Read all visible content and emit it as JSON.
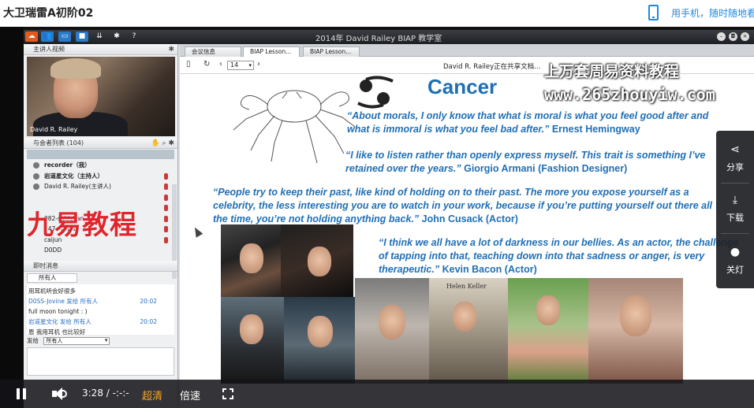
{
  "header": {
    "title": "大卫瑞雷A初阶02",
    "mobile_link": "用手机，随时随地看"
  },
  "app": {
    "title": "2014年 David Railey BIAP 教学室",
    "toolbar_icons": [
      "home-icon",
      "users-icon",
      "chat-icon",
      "video-icon",
      "download-icon",
      "gear-icon",
      "help-icon"
    ]
  },
  "left": {
    "host_video_label": "主讲人视频",
    "host_name": "David R. Railey",
    "participants_label": "与会者列表 (104)",
    "participants": [
      {
        "name": "recorder（我）",
        "bold": true
      },
      {
        "name": "岩道星文化（主持人）",
        "bold": true
      },
      {
        "name": "David R. Railey(主讲人)",
        "bold": false
      },
      {
        "name": "",
        "bold": false
      },
      {
        "name": "",
        "bold": false
      },
      {
        "name": "082-sukichan",
        "bold": false
      },
      {
        "name": "147-vivipan",
        "bold": false
      },
      {
        "name": "caijun",
        "bold": false
      },
      {
        "name": "D0DD",
        "bold": false
      }
    ],
    "watermark": "九易教程",
    "chat_label": "即时消息",
    "chat_tab": "所有人",
    "chat_messages": [
      {
        "text": "用耳机听会好很多",
        "time": "",
        "blue": false
      },
      {
        "text": "D0SS-Jovine 发给 所有人",
        "time": "20:02",
        "blue": true
      },
      {
        "text": "full moon tonight : )",
        "time": "",
        "blue": false
      },
      {
        "text": "岩道星文化 发给 所有人",
        "time": "20:02",
        "blue": true
      },
      {
        "text": "恩 我用耳机 也比较好",
        "time": "",
        "blue": false
      }
    ],
    "send_label": "发给",
    "send_target": "所有人"
  },
  "right": {
    "tabs": [
      "会议信息",
      "BIAP Lesson...",
      "BIAP Lesson..."
    ],
    "page_number": "14",
    "sharing_text": "David R. Railey正在共享文档...",
    "slide": {
      "title": "Cancer",
      "quotes": [
        {
          "text": "“About morals, I only know that what is moral is what you feel good after and what is immoral is what you feel bad after.”",
          "author": "Ernest Hemingway"
        },
        {
          "text": "“I like to listen rather than openly express myself.  This trait is something I’ve retained over the years.”",
          "author": "Giorgio Armani (Fashion Designer)"
        },
        {
          "text": "“People try to keep their past, like kind of holding on to their past.  The more you expose yourself as a celebrity, the less interesting you are to watch in your work, because if you’re putting yourself out there all the time, you’re not holding anything back.”",
          "author": "John Cusack (Actor)"
        },
        {
          "text": "“I think we all have a lot of darkness in our bellies. As an actor, the challenge of tapping into that, teaching down into that sadness or anger, is very therapeutic.”",
          "author": "Kevin Bacon (Actor)"
        }
      ],
      "photo_caption": "Helen Keller"
    }
  },
  "watermark": {
    "line1": "上万套周易资料教程",
    "line2": "www.265zhouyiw.com"
  },
  "side_panel": {
    "share": "分享",
    "download": "下载",
    "light": "关灯"
  },
  "controls": {
    "time": "3:28 / -:-:-",
    "quality": "超清",
    "speed": "倍速"
  }
}
